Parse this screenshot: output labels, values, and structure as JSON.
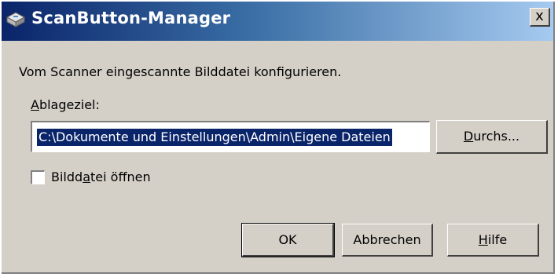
{
  "window": {
    "title": "ScanButton-Manager",
    "close_label": "x",
    "icon": "scanner-icon"
  },
  "description": "Vom Scanner eingescannte Bilddatei konfigurieren.",
  "target": {
    "label": "Ablageziel:",
    "value": "C:\\Dokumente und Einstellungen\\Admin\\Eigene Dateien",
    "browse_label": "Durchs..."
  },
  "open_file": {
    "label": "Bilddatei öffnen",
    "checked": false
  },
  "buttons": {
    "ok": "OK",
    "cancel": "Abbrechen",
    "help": "Hilfe"
  },
  "colors": {
    "titlebar_start": "#0a246a",
    "titlebar_end": "#a6caf0",
    "dialog_bg": "#d4d0c8",
    "selection": "#0a246a"
  }
}
